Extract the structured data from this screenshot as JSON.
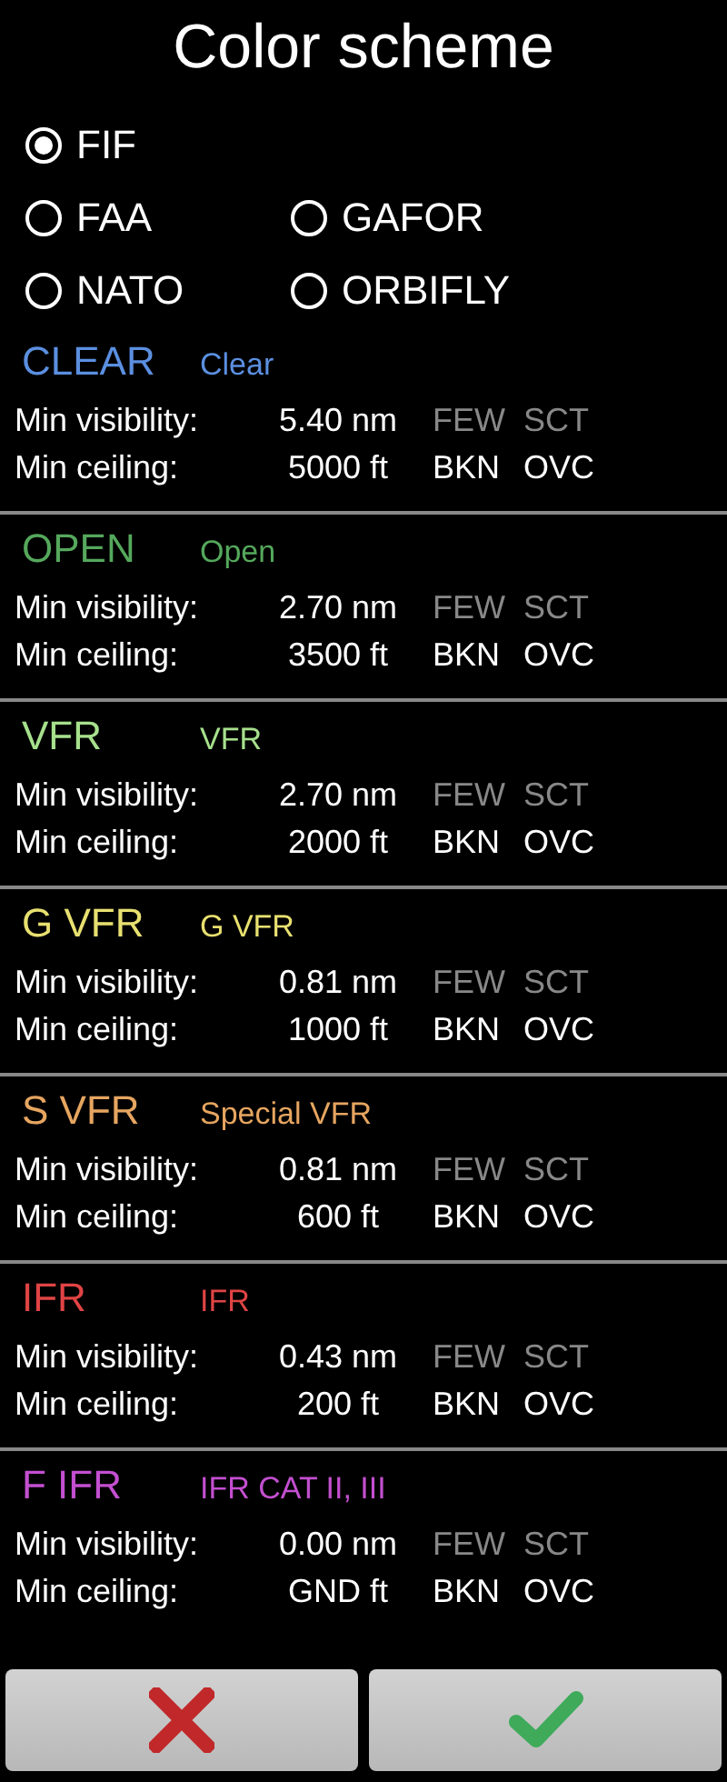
{
  "title": "Color scheme",
  "scheme_rows": [
    [
      {
        "label": "FIF",
        "selected": true
      }
    ],
    [
      {
        "label": "FAA",
        "selected": false
      },
      {
        "label": "GAFOR",
        "selected": false
      }
    ],
    [
      {
        "label": "NATO",
        "selected": false
      },
      {
        "label": "ORBIFLY",
        "selected": false
      }
    ]
  ],
  "categories": [
    {
      "name": "CLEAR",
      "description": "Clear",
      "color": "#5b8fe0",
      "visibility_label": "Min visibility:",
      "visibility": "5.40 nm",
      "ceiling_label": "Min ceiling:",
      "ceiling": "5000 ft",
      "clouds": [
        {
          "label": "FEW",
          "active": false
        },
        {
          "label": "SCT",
          "active": false
        },
        {
          "label": "BKN",
          "active": true
        },
        {
          "label": "OVC",
          "active": true
        }
      ]
    },
    {
      "name": "OPEN",
      "description": "Open",
      "color": "#55a85c",
      "visibility_label": "Min visibility:",
      "visibility": "2.70 nm",
      "ceiling_label": "Min ceiling:",
      "ceiling": "3500 ft",
      "clouds": [
        {
          "label": "FEW",
          "active": false
        },
        {
          "label": "SCT",
          "active": false
        },
        {
          "label": "BKN",
          "active": true
        },
        {
          "label": "OVC",
          "active": true
        }
      ]
    },
    {
      "name": "VFR",
      "description": "VFR",
      "color": "#a6e08c",
      "visibility_label": "Min visibility:",
      "visibility": "2.70 nm",
      "ceiling_label": "Min ceiling:",
      "ceiling": "2000 ft",
      "clouds": [
        {
          "label": "FEW",
          "active": false
        },
        {
          "label": "SCT",
          "active": false
        },
        {
          "label": "BKN",
          "active": true
        },
        {
          "label": "OVC",
          "active": true
        }
      ]
    },
    {
      "name": "G VFR",
      "description": "G VFR",
      "color": "#e8e070",
      "visibility_label": "Min visibility:",
      "visibility": "0.81 nm",
      "ceiling_label": "Min ceiling:",
      "ceiling": "1000 ft",
      "clouds": [
        {
          "label": "FEW",
          "active": false
        },
        {
          "label": "SCT",
          "active": false
        },
        {
          "label": "BKN",
          "active": true
        },
        {
          "label": "OVC",
          "active": true
        }
      ]
    },
    {
      "name": "S VFR",
      "description": "Special VFR",
      "color": "#e6a560",
      "visibility_label": "Min visibility:",
      "visibility": "0.81 nm",
      "ceiling_label": "Min ceiling:",
      "ceiling": "600 ft",
      "clouds": [
        {
          "label": "FEW",
          "active": false
        },
        {
          "label": "SCT",
          "active": false
        },
        {
          "label": "BKN",
          "active": true
        },
        {
          "label": "OVC",
          "active": true
        }
      ]
    },
    {
      "name": "IFR",
      "description": "IFR",
      "color": "#e04444",
      "visibility_label": "Min visibility:",
      "visibility": "0.43 nm",
      "ceiling_label": "Min ceiling:",
      "ceiling": "200 ft",
      "clouds": [
        {
          "label": "FEW",
          "active": false
        },
        {
          "label": "SCT",
          "active": false
        },
        {
          "label": "BKN",
          "active": true
        },
        {
          "label": "OVC",
          "active": true
        }
      ]
    },
    {
      "name": "F IFR",
      "description": "IFR CAT II, III",
      "color": "#c34fd0",
      "visibility_label": "Min visibility:",
      "visibility": "0.00 nm",
      "ceiling_label": "Min ceiling:",
      "ceiling": "GND ft",
      "clouds": [
        {
          "label": "FEW",
          "active": false
        },
        {
          "label": "SCT",
          "active": false
        },
        {
          "label": "BKN",
          "active": true
        },
        {
          "label": "OVC",
          "active": true
        }
      ]
    }
  ]
}
